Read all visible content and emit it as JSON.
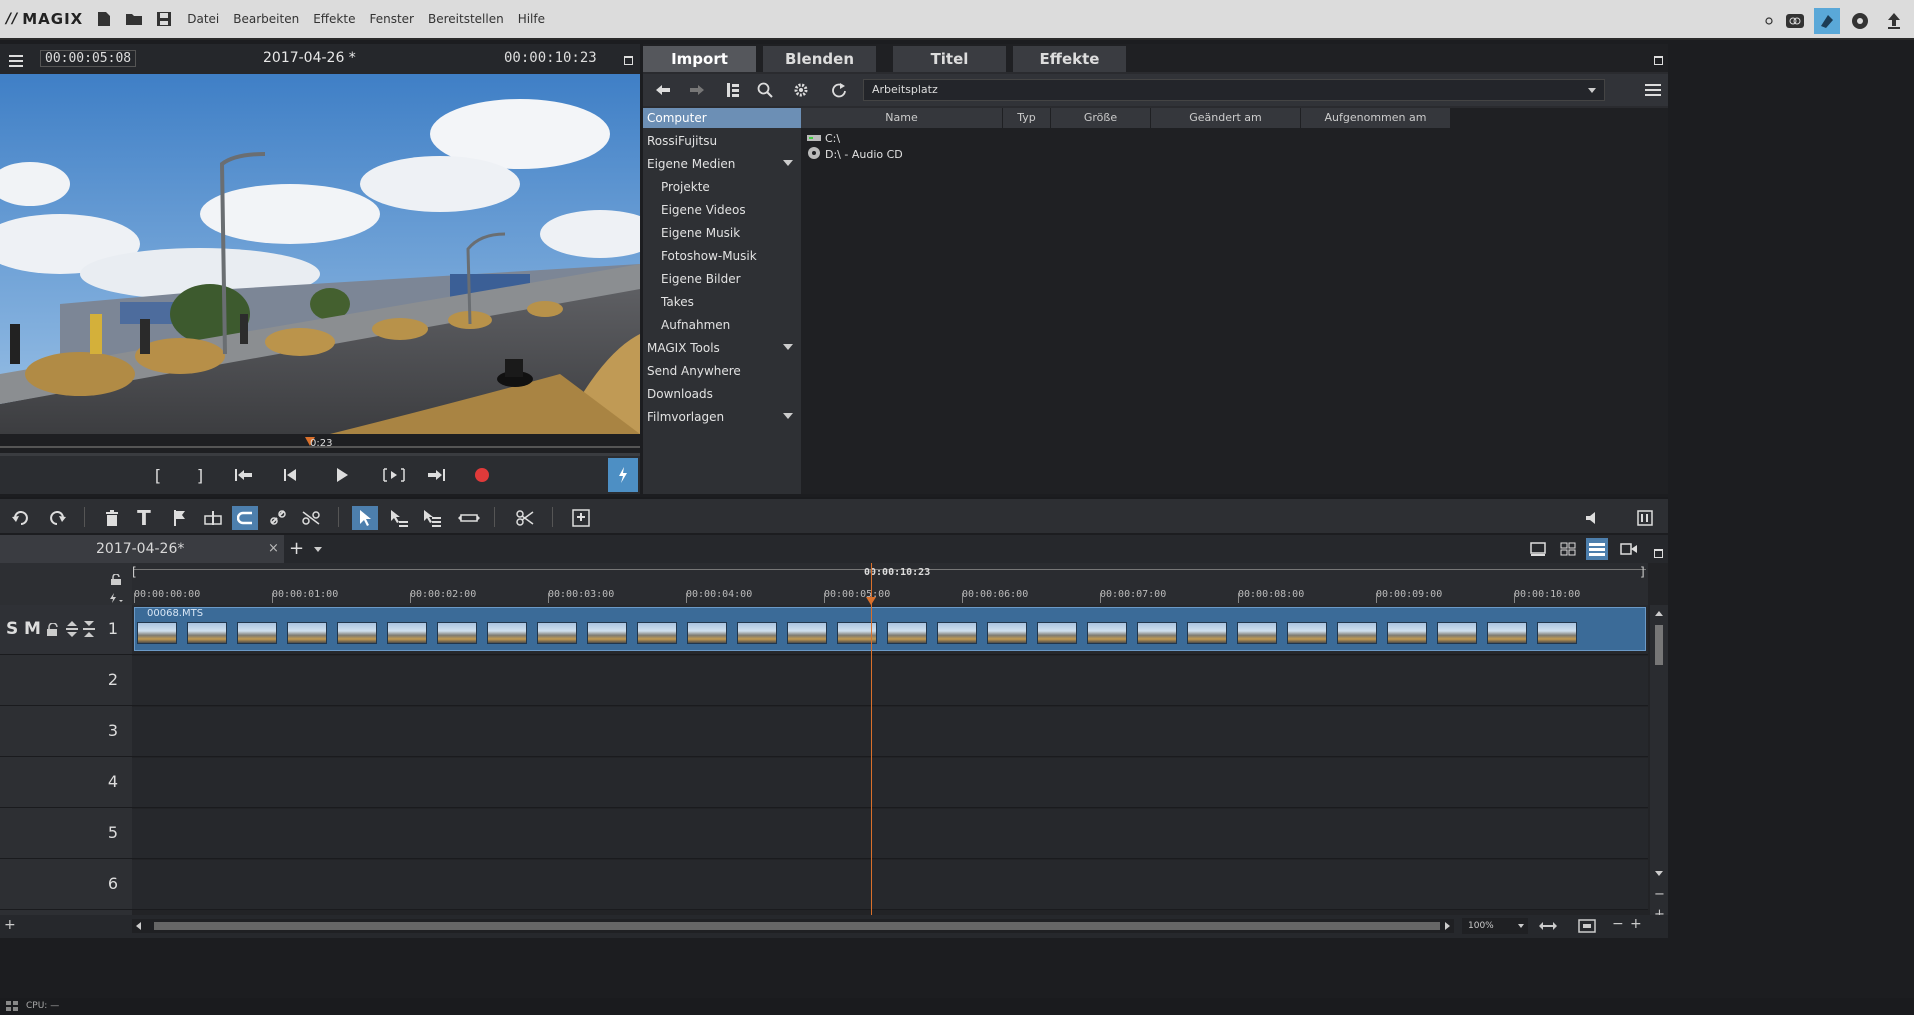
{
  "app": {
    "logo_text": "MAGIX",
    "menu": [
      "Datei",
      "Bearbeiten",
      "Effekte",
      "Fenster",
      "Bereitstellen",
      "Hilfe"
    ]
  },
  "preview": {
    "timecode_position": "00:00:05:08",
    "title": "2017-04-26 *",
    "timecode_length": "00:00:10:23",
    "scrub_label": "0:23"
  },
  "pool": {
    "tabs": [
      "Import",
      "Blenden",
      "Titel",
      "Effekte"
    ],
    "active_tab": "Import",
    "path": "Arbeitsplatz",
    "tree": [
      {
        "label": "Computer",
        "child": false,
        "selected": true,
        "expandable": false
      },
      {
        "label": "RossiFujitsu",
        "child": false,
        "selected": false,
        "expandable": false
      },
      {
        "label": "Eigene Medien",
        "child": false,
        "selected": false,
        "expandable": true
      },
      {
        "label": "Projekte",
        "child": true,
        "selected": false,
        "expandable": false
      },
      {
        "label": "Eigene Videos",
        "child": true,
        "selected": false,
        "expandable": false
      },
      {
        "label": "Eigene Musik",
        "child": true,
        "selected": false,
        "expandable": false
      },
      {
        "label": "Fotoshow-Musik",
        "child": true,
        "selected": false,
        "expandable": false
      },
      {
        "label": "Eigene Bilder",
        "child": true,
        "selected": false,
        "expandable": false
      },
      {
        "label": "Takes",
        "child": true,
        "selected": false,
        "expandable": false
      },
      {
        "label": "Aufnahmen",
        "child": true,
        "selected": false,
        "expandable": false
      },
      {
        "label": "MAGIX Tools",
        "child": false,
        "selected": false,
        "expandable": true
      },
      {
        "label": "Send Anywhere",
        "child": false,
        "selected": false,
        "expandable": false
      },
      {
        "label": "Downloads",
        "child": false,
        "selected": false,
        "expandable": false
      },
      {
        "label": "Filmvorlagen",
        "child": false,
        "selected": false,
        "expandable": true
      }
    ],
    "columns": [
      "Name",
      "Typ",
      "Größe",
      "Geändert am",
      "Aufgenommen am"
    ],
    "files": [
      {
        "name": "C:\\",
        "icon": "drive-icon"
      },
      {
        "name": "D:\\ - Audio CD",
        "icon": "cd-icon"
      }
    ]
  },
  "project": {
    "tab_label": "2017-04-26*",
    "ruler_total": "00:00:10:23",
    "ruler_labels": [
      "00:00:00:00",
      "00:00:01:00",
      "00:00:02:00",
      "00:00:03:00",
      "00:00:04:00",
      "00:00:05:00",
      "00:00:06:00",
      "00:00:07:00",
      "00:00:08:00",
      "00:00:09:00",
      "00:00:10:00"
    ],
    "track_numbers": [
      "1",
      "2",
      "3",
      "4",
      "5",
      "6"
    ],
    "track_controls": [
      "S",
      "M"
    ],
    "clip_name": "00068.MTS",
    "zoom_label": "100%"
  },
  "status": {
    "cpu": "CPU: —"
  },
  "colors": {
    "accent": "#4d7fad",
    "playhead": "#d9702b",
    "record": "#e03a3a",
    "clip": "#3b6b98"
  }
}
